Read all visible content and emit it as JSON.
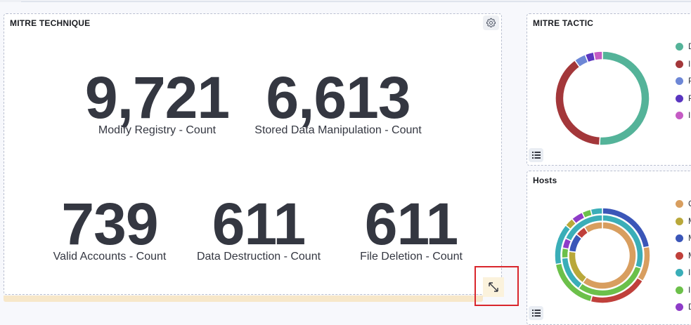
{
  "technique_panel": {
    "title": "MITRE TECHNIQUE",
    "metrics": [
      {
        "value": "9,721",
        "label": "Modify Registry - Count"
      },
      {
        "value": "6,613",
        "label": "Stored Data Manipulation - Count"
      },
      {
        "value": "739",
        "label": "Valid Accounts - Count"
      },
      {
        "value": "611",
        "label": "Data Destruction - Count"
      },
      {
        "value": "611",
        "label": "File Deletion - Count"
      }
    ]
  },
  "tactic_panel": {
    "title": "MITRE TACTIC",
    "legend": [
      {
        "text": "D",
        "color": "#54b399"
      },
      {
        "text": "I",
        "color": "#a3373a"
      },
      {
        "text": "P",
        "color": "#6d87d6"
      },
      {
        "text": "P",
        "color": "#5a36c0"
      },
      {
        "text": "I",
        "color": "#c55bc4"
      }
    ],
    "chart_data": {
      "type": "pie",
      "slices": [
        {
          "label": "D",
          "value": 51,
          "color": "#54b399"
        },
        {
          "label": "I",
          "value": 39,
          "color": "#a3373a"
        },
        {
          "label": "P",
          "value": 4,
          "color": "#6d87d6"
        },
        {
          "label": "P",
          "value": 3,
          "color": "#5a36c0"
        },
        {
          "label": "I",
          "value": 3,
          "color": "#c55bc4"
        }
      ]
    }
  },
  "hosts_panel": {
    "title": "Hosts",
    "legend": [
      {
        "text": "C",
        "color": "#d89e5f"
      },
      {
        "text": "M",
        "color": "#b9a83a"
      },
      {
        "text": "M",
        "color": "#3b56b8"
      },
      {
        "text": "M",
        "color": "#c0403b"
      },
      {
        "text": "I",
        "color": "#3aaeb8"
      },
      {
        "text": "I",
        "color": "#6cc04a"
      },
      {
        "text": "D",
        "color": "#8e3cc8"
      }
    ],
    "chart_data": {
      "type": "pie",
      "rings": [
        {
          "slices": [
            {
              "value": 60,
              "color": "#d89e5f"
            },
            {
              "value": 17,
              "color": "#b9a83a"
            },
            {
              "value": 9,
              "color": "#3b56b8"
            },
            {
              "value": 5,
              "color": "#c0403b"
            },
            {
              "value": 9,
              "color": "#d89e5f"
            }
          ]
        },
        {
          "slices": [
            {
              "value": 30,
              "color": "#3aaeb8"
            },
            {
              "value": 30,
              "color": "#6cc04a"
            },
            {
              "value": 14,
              "color": "#3aaeb8"
            },
            {
              "value": 4,
              "color": "#6cc04a"
            },
            {
              "value": 4,
              "color": "#8e3cc8"
            },
            {
              "value": 18,
              "color": "#3aaeb8"
            }
          ]
        },
        {
          "slices": [
            {
              "value": 22,
              "color": "#3b56b8"
            },
            {
              "value": 12,
              "color": "#d89e5f"
            },
            {
              "value": 20,
              "color": "#c0403b"
            },
            {
              "value": 18,
              "color": "#6cc04a"
            },
            {
              "value": 14,
              "color": "#3aaeb8"
            },
            {
              "value": 3,
              "color": "#b9a83a"
            },
            {
              "value": 4,
              "color": "#8e3cc8"
            },
            {
              "value": 3,
              "color": "#6cc04a"
            },
            {
              "value": 4,
              "color": "#3aaeb8"
            }
          ]
        }
      ]
    }
  }
}
